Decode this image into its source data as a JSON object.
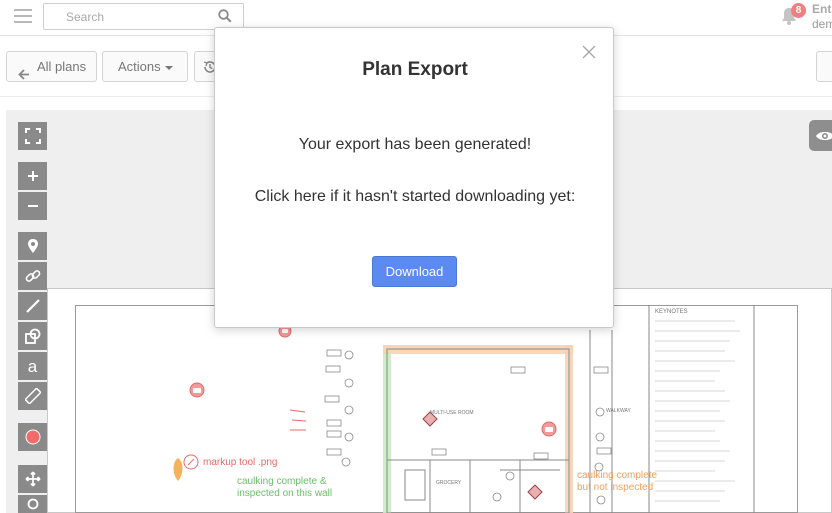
{
  "topbar": {
    "search_placeholder": "Search",
    "notification_count": "8",
    "user_line1": "Ent",
    "user_line2": "dem"
  },
  "toolbar": {
    "all_plans_label": "All plans",
    "actions_label": "Actions"
  },
  "plan": {
    "markup_label": "markup tool .png",
    "green_note_line1": "caulking complete &",
    "green_note_line2": "inspected on this wall",
    "orange_note_line1": "caulking complete",
    "orange_note_line2": "but not inspected",
    "keynotes_title": "KEYNOTES",
    "room_label": "MULTI-USE ROOM",
    "room2_label": "GROCERY",
    "walkway_label": "WALKWAY"
  },
  "colors": {
    "accent": "#5b8bf0",
    "badge": "#f08080",
    "markup_red": "#e86a6a",
    "markup_green": "#6bbf6b",
    "markup_orange": "#f2a05a"
  },
  "modal": {
    "title": "Plan Export",
    "message": "Your export has been generated!",
    "prompt": "Click here if it hasn't started downloading yet:",
    "download_label": "Download"
  }
}
